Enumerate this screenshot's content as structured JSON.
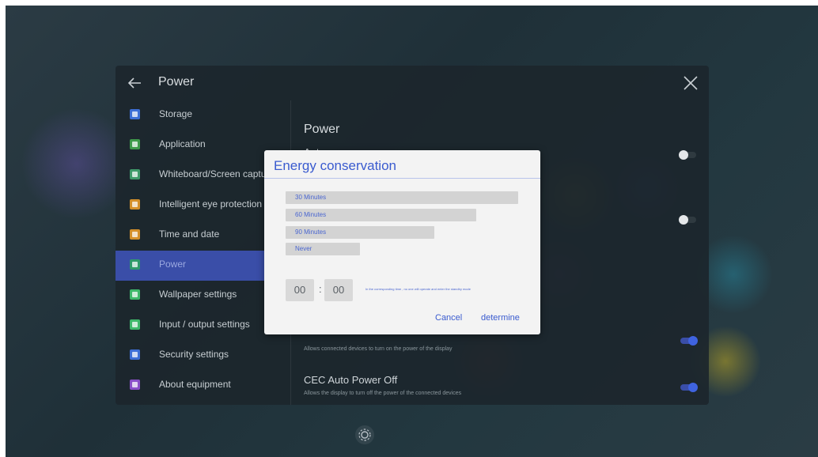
{
  "header": {
    "title": "Power"
  },
  "sidebar": {
    "items": [
      {
        "label": "Storage",
        "color": "#3d6fd6"
      },
      {
        "label": "Application",
        "color": "#3f9a4a"
      },
      {
        "label": "Whiteboard/Screen capture",
        "color": "#3f9a6a"
      },
      {
        "label": "Intelligent eye protection",
        "color": "#d4902a"
      },
      {
        "label": "Time and date",
        "color": "#d4902a"
      },
      {
        "label": "Power",
        "color": "#2f9a6a"
      },
      {
        "label": "Wallpaper settings",
        "color": "#3fb86a"
      },
      {
        "label": "Input / output settings",
        "color": "#3fb86a"
      },
      {
        "label": "Security settings",
        "color": "#3d6fd6"
      },
      {
        "label": "About equipment",
        "color": "#8a4fc8"
      }
    ],
    "active_index": 5
  },
  "content": {
    "section_title": "Power",
    "settings": [
      {
        "title": "Auto power on",
        "toggle": "off"
      },
      {
        "title": "",
        "toggle": "off"
      },
      {
        "title": "",
        "description": "Allows connected devices to turn on the power of the display",
        "toggle": "on"
      },
      {
        "title": "CEC Auto Power Off",
        "description": "Allows the display to turn off the power of the connected devices",
        "toggle": "on"
      }
    ]
  },
  "dialog": {
    "title": "Energy conservation",
    "options": [
      {
        "label": "30 Minutes",
        "fill": 1.0
      },
      {
        "label": "60 Minutes",
        "fill": 0.82
      },
      {
        "label": "90 Minutes",
        "fill": 0.64
      },
      {
        "label": "Never",
        "fill": 0.32
      }
    ],
    "time": {
      "hours": "00",
      "minutes": "00",
      "separator": ":"
    },
    "hint": "In the corresponding time , no one will operate and enter the standby mode",
    "cancel_label": "Cancel",
    "confirm_label": "determine"
  },
  "colors": {
    "accent": "#3a5bcf",
    "active_bg": "#3a4ea8"
  }
}
